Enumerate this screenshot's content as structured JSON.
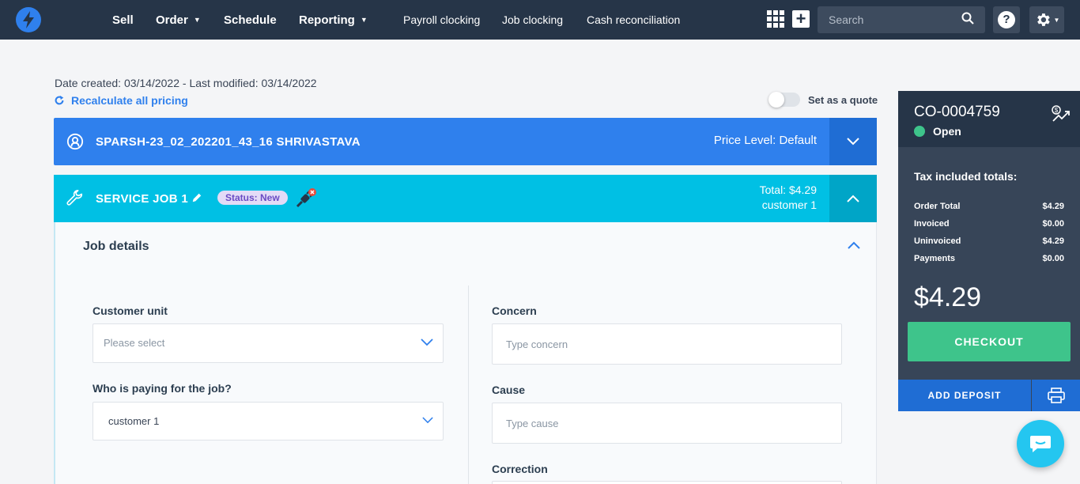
{
  "nav": {
    "main": [
      "Sell",
      "Order",
      "Schedule",
      "Reporting"
    ],
    "sub": [
      "Payroll clocking",
      "Job clocking",
      "Cash reconciliation"
    ],
    "search_placeholder": "Search",
    "help_label": "?"
  },
  "meta": {
    "dates": "Date created: 03/14/2022 - Last modified: 03/14/2022",
    "recalc": "Recalculate all pricing",
    "quote_label": "Set as a quote"
  },
  "customer": {
    "name": "SPARSH-23_02_202201_43_16 SHRIVASTAVA",
    "price_level": "Price Level: Default"
  },
  "service": {
    "title": "SERVICE JOB 1",
    "status": "Status: New",
    "total": "Total: $4.29",
    "payer": "customer 1"
  },
  "job": {
    "heading": "Job details",
    "customer_unit_label": "Customer unit",
    "customer_unit_placeholder": "Please select",
    "payer_label": "Who is paying for the job?",
    "payer_value": "customer 1",
    "concern_label": "Concern",
    "concern_placeholder": "Type concern",
    "cause_label": "Cause",
    "cause_placeholder": "Type cause",
    "correction_label": "Correction"
  },
  "summary": {
    "order_no": "CO-0004759",
    "status": "Open",
    "tax_heading": "Tax included totals:",
    "rows": [
      {
        "label": "Order Total",
        "value": "$4.29"
      },
      {
        "label": "Invoiced",
        "value": "$0.00"
      },
      {
        "label": "Uninvoiced",
        "value": "$4.29"
      },
      {
        "label": "Payments",
        "value": "$0.00"
      }
    ],
    "big_total": "$4.29",
    "checkout": "CHECKOUT",
    "add_deposit": "ADD DEPOSIT"
  },
  "colors": {
    "nav_bg": "#263548",
    "customer_bar": "#2f80ed",
    "service_bar": "#00c0e4",
    "checkout": "#3ec48b",
    "status_open": "#3ec48b"
  }
}
